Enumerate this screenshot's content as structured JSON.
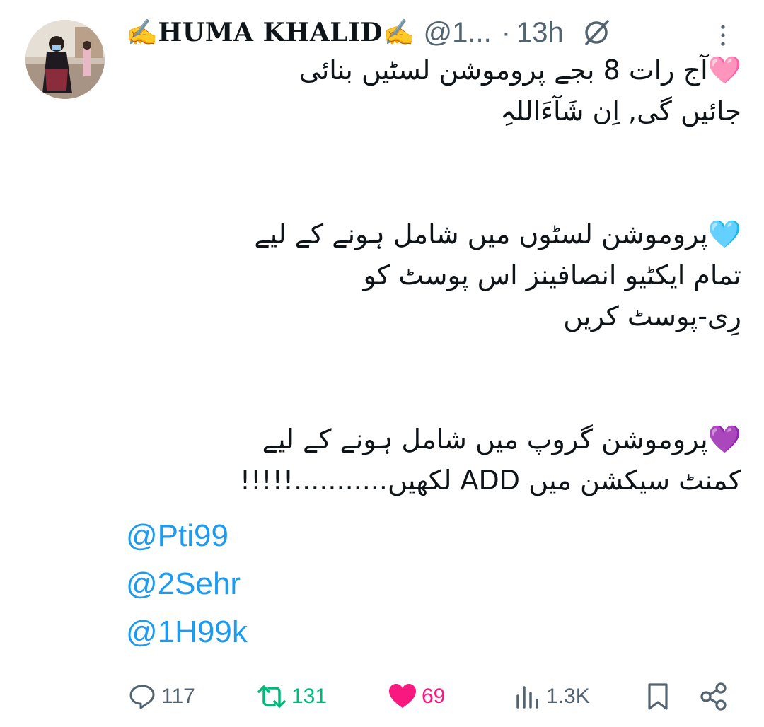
{
  "tweet": {
    "display_name": "✍HUMA KHALID✍",
    "handle": "@1...",
    "separator": "·",
    "time": "13h",
    "paragraphs": [
      {
        "lines": [
          "🩷آج رات 8 بجے پروموشن لسٹیں بنائی",
          "جائیں گی, اِن شَآءَاللہِ"
        ],
        "emoji_color": "#ff8fc1"
      },
      {
        "lines": [
          "🩵پروموشن لسٹوں میں شامل ہونے کے لیے",
          "تمام ایکٹیو انصافینز اس پوسٹ کو",
          "رِی-پوسٹ کریں"
        ],
        "emoji_color": "#7fd8f5"
      },
      {
        "lines": [
          "💜پروموشن گروپ میں شامل ہونے کے لیے",
          "کمنٹ سیکشن میں ADD لکھیں...........!!!!!"
        ],
        "emoji_color": "#a259e6"
      }
    ],
    "mentions": [
      "@Pti99",
      "@2Sehr",
      "@1H99k"
    ]
  },
  "actions": {
    "replies": "117",
    "reposts": "131",
    "likes": "69",
    "views": "1.3K"
  },
  "icons": {
    "avatar": "user-photo-avatar",
    "grok": "grok-icon",
    "more": "more-vertical-icon",
    "reply": "reply-icon",
    "retweet": "retweet-icon",
    "like": "heart-filled-icon",
    "views": "analytics-icon",
    "bookmark": "bookmark-icon",
    "share": "share-icon"
  },
  "colors": {
    "link": "#1d9bf0",
    "muted": "#536471",
    "retweet_active": "#00ba7c",
    "like_active": "#f91880"
  }
}
